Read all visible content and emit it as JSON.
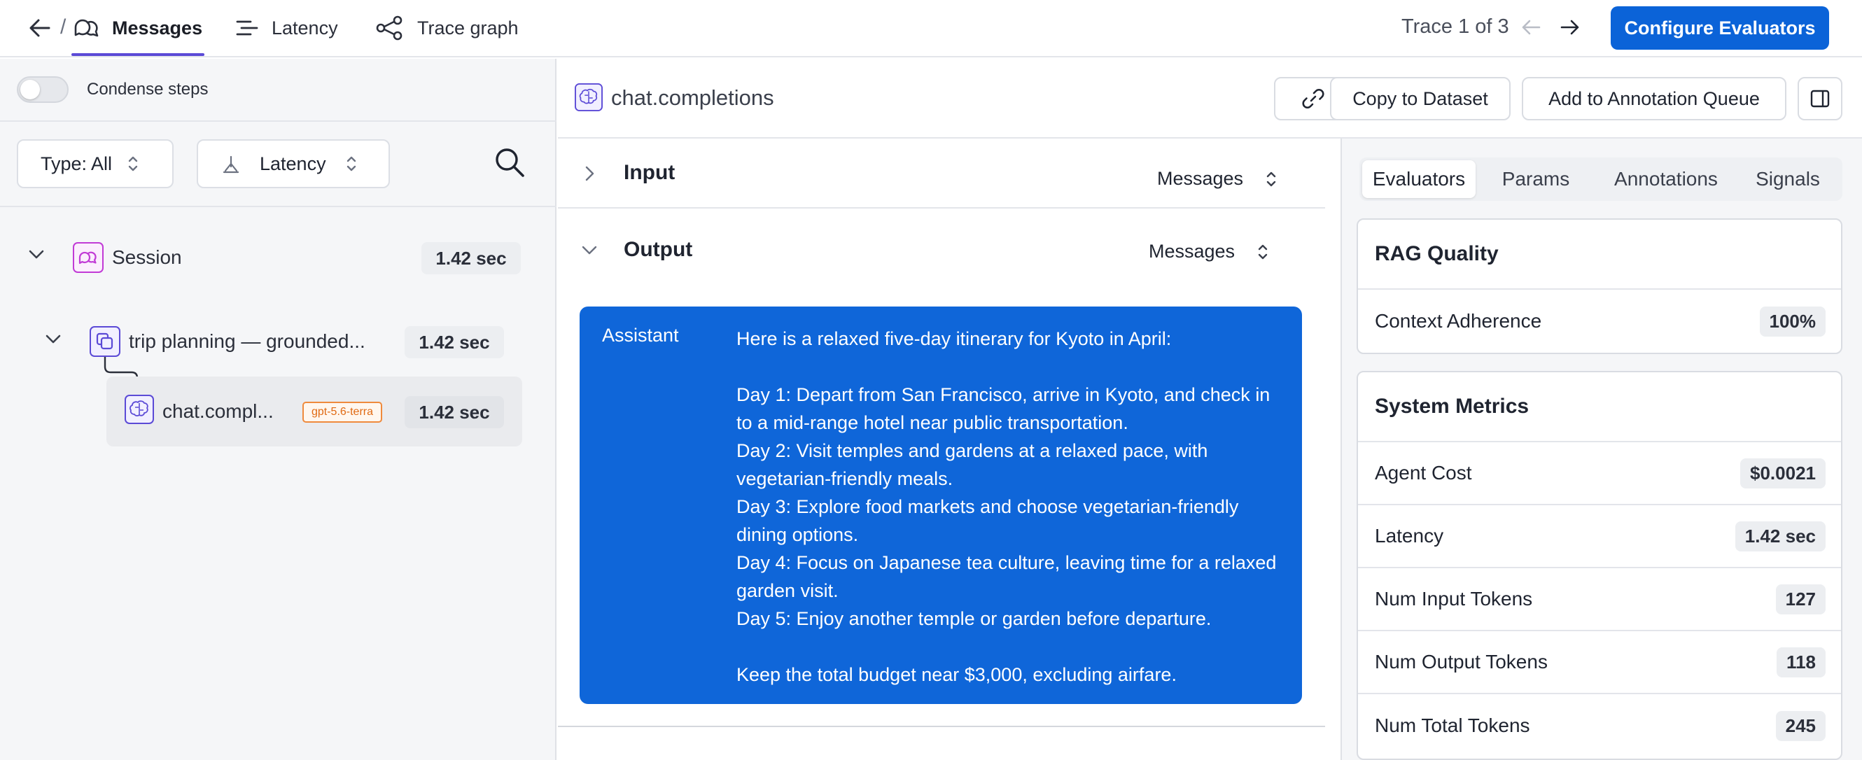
{
  "header": {
    "tabs": [
      {
        "label": "Messages",
        "icon": "chat-bubbles-icon",
        "active": true
      },
      {
        "label": "Latency",
        "icon": "bars-icon"
      },
      {
        "label": "Trace graph",
        "icon": "graph-icon"
      }
    ],
    "breadcrumb_separator": "/",
    "trace_indicator": "Trace 1 of 3",
    "configure_button": "Configure Evaluators"
  },
  "left": {
    "condense_label": "Condense steps",
    "condense_on": false,
    "type_filter": "Type: All",
    "sort_select": "Latency",
    "tree": {
      "session": {
        "label": "Session",
        "time": "1.42 sec"
      },
      "workflow": {
        "label": "trip planning — grounded...",
        "time": "1.42 sec"
      },
      "llm": {
        "label": "chat.compl...",
        "model": "gpt-5.6-terra",
        "time": "1.42 sec"
      }
    }
  },
  "middle": {
    "title": "chat.completions",
    "copy_dataset": "Copy to Dataset",
    "add_queue": "Add to Annotation Queue",
    "input": {
      "label": "Input",
      "format": "Messages"
    },
    "output": {
      "label": "Output",
      "format": "Messages"
    },
    "message": {
      "role": "Assistant",
      "content": "Here is a relaxed five-day itinerary for Kyoto in April:\n\nDay 1: Depart from San Francisco, arrive in Kyoto, and check in to a mid-range hotel near public transportation.\nDay 2: Visit temples and gardens at a relaxed pace, with vegetarian-friendly meals.\nDay 3: Explore food markets and choose vegetarian-friendly dining options.\nDay 4: Focus on Japanese tea culture, leaving time for a relaxed garden visit.\nDay 5: Enjoy another temple or garden before departure.\n\nKeep the total budget near $3,000, excluding airfare."
    }
  },
  "right": {
    "tabs": [
      "Evaluators",
      "Params",
      "Annotations",
      "Signals"
    ],
    "rag": {
      "title": "RAG Quality",
      "metrics": [
        {
          "label": "Context Adherence",
          "value": "100%"
        }
      ]
    },
    "system": {
      "title": "System Metrics",
      "metrics": [
        {
          "label": "Agent Cost",
          "value": "$0.0021"
        },
        {
          "label": "Latency",
          "value": "1.42 sec"
        },
        {
          "label": "Num Input Tokens",
          "value": "127"
        },
        {
          "label": "Num Output Tokens",
          "value": "118"
        },
        {
          "label": "Num Total Tokens",
          "value": "245"
        }
      ]
    }
  },
  "colors": {
    "accent": "#0b63d8",
    "tab_underline": "#5b4ad6",
    "model_tag": "#ef8a3c",
    "node_purple": "#c13bd6",
    "node_indigo": "#5b4ad6"
  }
}
